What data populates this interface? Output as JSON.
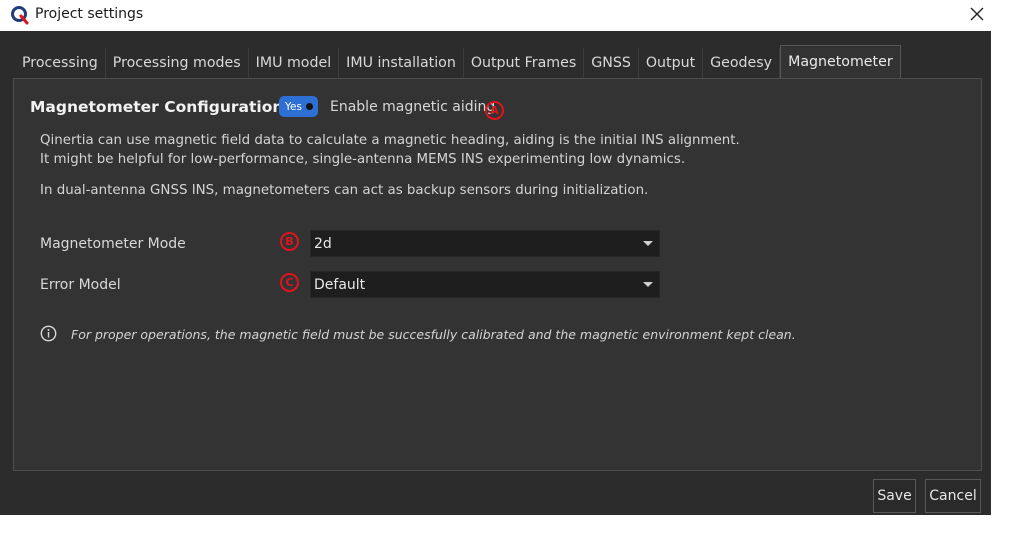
{
  "window": {
    "title": "Project settings",
    "app_icon": "qinertia-logo-icon",
    "close_icon": "close-icon"
  },
  "tabs": [
    {
      "label": "Processing",
      "active": false
    },
    {
      "label": "Processing modes",
      "active": false
    },
    {
      "label": "IMU model",
      "active": false
    },
    {
      "label": "IMU installation",
      "active": false
    },
    {
      "label": "Output Frames",
      "active": false
    },
    {
      "label": "GNSS",
      "active": false
    },
    {
      "label": "Output",
      "active": false
    },
    {
      "label": "Geodesy",
      "active": false
    },
    {
      "label": "Magnetometer",
      "active": true
    }
  ],
  "magnetometer": {
    "section_title": "Magnetometer Configuration",
    "toggle": {
      "label": "Yes",
      "state": "on"
    },
    "enable_label": "Enable magnetic aiding",
    "description_line1": "Qinertia can use magnetic field data to calculate a magnetic heading, aiding is the initial INS alignment.",
    "description_line2": "It might be helpful for low-performance, single-antenna MEMS INS experimenting low dynamics.",
    "description_line3": "In dual-antenna GNSS INS, magnetometers can act as backup sensors during initialization.",
    "mode": {
      "label": "Magnetometer Mode",
      "value": "2d"
    },
    "error_model": {
      "label": "Error Model",
      "value": "Default"
    },
    "info_icon": "info-icon",
    "info_text": "For proper operations, the magnetic field must be succesfully calibrated and the magnetic environment kept clean."
  },
  "markers": {
    "a": "A",
    "b": "B",
    "c": "C"
  },
  "buttons": {
    "save": "Save",
    "cancel": "Cancel"
  },
  "colors": {
    "background": "#2c2c2c",
    "panel": "#333333",
    "toggle_accent": "#2d6fd2",
    "marker_red": "#e0141c"
  }
}
